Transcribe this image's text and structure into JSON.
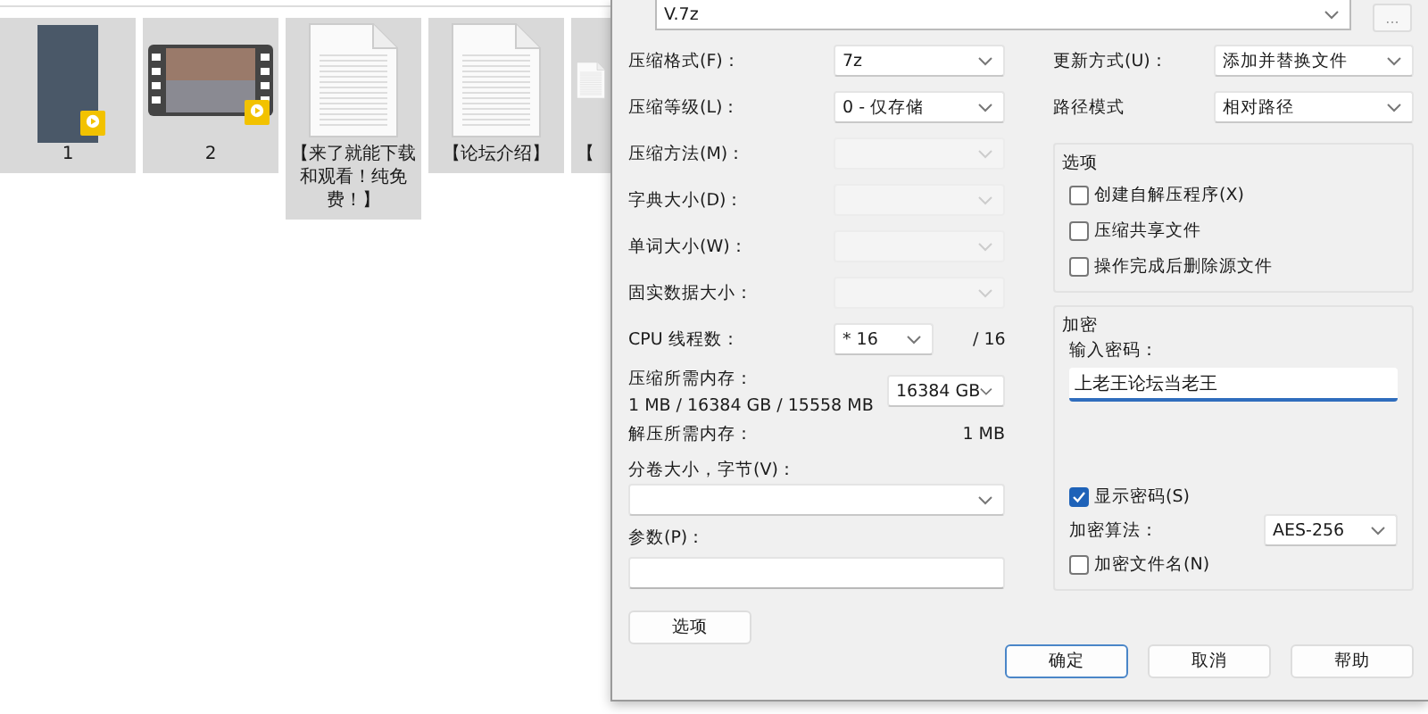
{
  "file_tiles": [
    {
      "kind": "photo",
      "label": "1"
    },
    {
      "kind": "video",
      "label": "2"
    },
    {
      "kind": "document",
      "label": "【来了就能下载和观看！纯免费！】"
    },
    {
      "kind": "document",
      "label": "【论坛介绍】"
    },
    {
      "kind": "document",
      "label": "【"
    }
  ],
  "dialog": {
    "archive_name": "V.7z",
    "browse_button": "...",
    "left_rows": [
      {
        "kind": "combo",
        "label": "压缩格式(F)：",
        "value": "7z",
        "disabled": false
      },
      {
        "kind": "combo",
        "label": "压缩等级(L)：",
        "value": "0 - 仅存储",
        "disabled": false
      },
      {
        "kind": "combo",
        "label": "压缩方法(M)：",
        "disabled": true
      },
      {
        "kind": "combo",
        "label": "字典大小(D)：",
        "disabled": true
      },
      {
        "kind": "combo",
        "label": "单词大小(W)：",
        "disabled": true
      },
      {
        "kind": "combo",
        "label": "固实数据大小：",
        "disabled": true
      },
      {
        "kind": "threads",
        "label": "CPU 线程数：",
        "value": "* 16",
        "suffix": "/ 16",
        "disabled": false
      }
    ],
    "compress_memory": {
      "label": "压缩所需内存：",
      "value": "1 MB / 16384 GB / 15558 MB",
      "limit": "16384 GB"
    },
    "decompress_memory": {
      "label": "解压所需内存：",
      "value": "1 MB"
    },
    "volume_size": {
      "label": "分卷大小，字节(V)："
    },
    "parameters": {
      "label": "参数(P)："
    },
    "options_button": "选项",
    "update_mode": {
      "label": "更新方式(U)：",
      "value": "添加并替换文件"
    },
    "path_mode": {
      "label": "路径模式",
      "value": "相对路径"
    },
    "options_group": {
      "title": "选项",
      "checkboxes": [
        {
          "label": "创建自解压程序(X)",
          "checked": false
        },
        {
          "label": "压缩共享文件",
          "checked": false
        },
        {
          "label": "操作完成后删除源文件",
          "checked": false
        }
      ]
    },
    "encryption": {
      "title": "加密",
      "password_label": "输入密码：",
      "password": "上老王论坛当老王",
      "show_password": {
        "label": "显示密码(S)",
        "checked": true
      },
      "method_label": "加密算法：",
      "method": "AES-256",
      "encrypt_names": {
        "label": "加密文件名(N)",
        "checked": false
      }
    },
    "buttons": [
      {
        "label": "确定",
        "default": true
      },
      {
        "label": "取消",
        "default": false
      },
      {
        "label": "帮助",
        "default": false
      }
    ]
  }
}
